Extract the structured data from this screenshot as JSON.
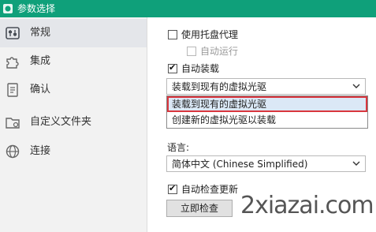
{
  "window": {
    "title": "参数选择"
  },
  "sidebar": {
    "items": [
      {
        "label": "常规",
        "icon": "settings-panel-icon",
        "active": true
      },
      {
        "label": "集成",
        "icon": "puzzle-icon",
        "active": false
      },
      {
        "label": "确认",
        "icon": "document-icon",
        "active": false
      },
      {
        "label": "自定义文件夹",
        "icon": "folder-gear-icon",
        "active": false
      },
      {
        "label": "连接",
        "icon": "globe-icon",
        "active": false
      }
    ]
  },
  "general": {
    "use_tray_agent": {
      "label": "使用托盘代理",
      "checked": false
    },
    "auto_run": {
      "label": "自动运行",
      "checked": false,
      "disabled": true
    },
    "auto_mount": {
      "label": "自动装载",
      "checked": true
    },
    "mount_mode": {
      "selected": "装载到现有的虚拟光驱",
      "options": [
        "装载到现有的虚拟光驱",
        "创建新的虚拟光驱以装载"
      ]
    },
    "language": {
      "label": "语言:",
      "selected": "简体中文 (Chinese Simplified)"
    },
    "auto_check_updates": {
      "label": "自动检查更新",
      "checked": true
    },
    "check_now_button": "立即检查"
  },
  "watermark": "2xiazai.com",
  "colors": {
    "titlebar": "#0fa07a",
    "highlight_border": "#d9363e",
    "highlight_bg": "#dbe8f6"
  }
}
